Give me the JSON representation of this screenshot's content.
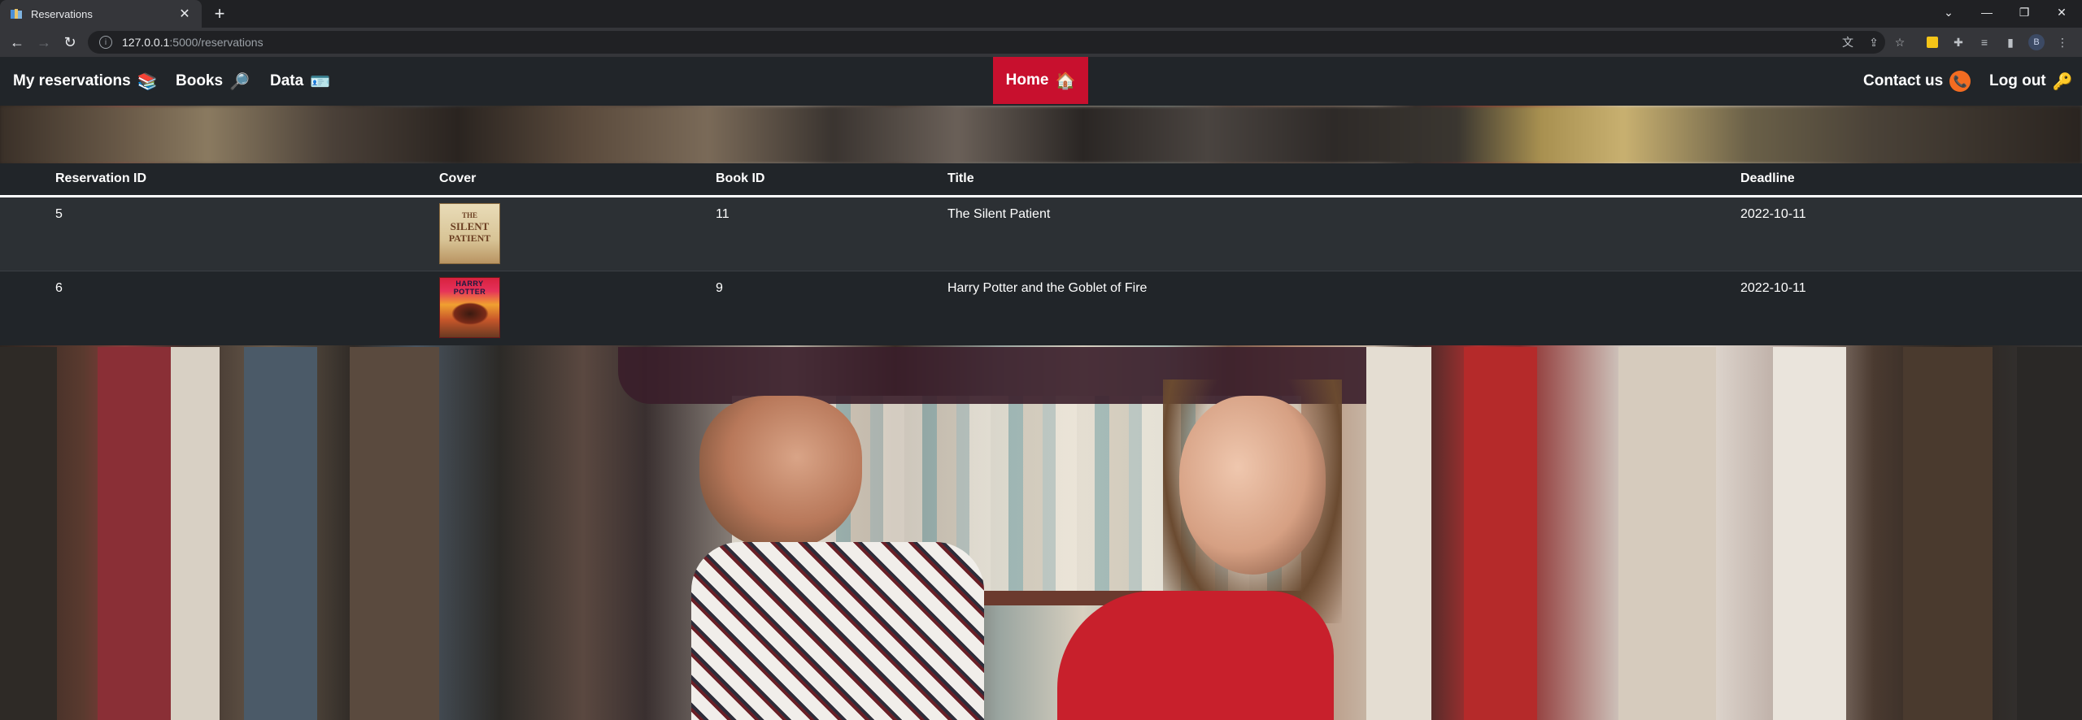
{
  "browser": {
    "tab_title": "Reservations",
    "url_host": "127.0.0.1",
    "url_path": ":5000/reservations",
    "profile_initial": "B"
  },
  "navbar": {
    "my_reservations": "My reservations",
    "my_reservations_emoji": "📚",
    "books": "Books",
    "books_emoji": "🔎",
    "data": "Data",
    "data_emoji": "🪪",
    "home": "Home",
    "home_emoji": "🏠",
    "contact_us": "Contact us",
    "contact_emoji": "📞",
    "log_out": "Log out",
    "log_out_emoji": "🔑",
    "home_color": "#c8102e"
  },
  "table": {
    "headers": [
      "Reservation ID",
      "Cover",
      "Book ID",
      "Title",
      "Deadline"
    ],
    "rows": [
      {
        "reservation_id": "5",
        "book_id": "11",
        "title": "The Silent Patient",
        "deadline": "2022-10-11"
      },
      {
        "reservation_id": "6",
        "book_id": "9",
        "title": "Harry Potter and the Goblet of Fire",
        "deadline": "2022-10-11"
      }
    ]
  }
}
